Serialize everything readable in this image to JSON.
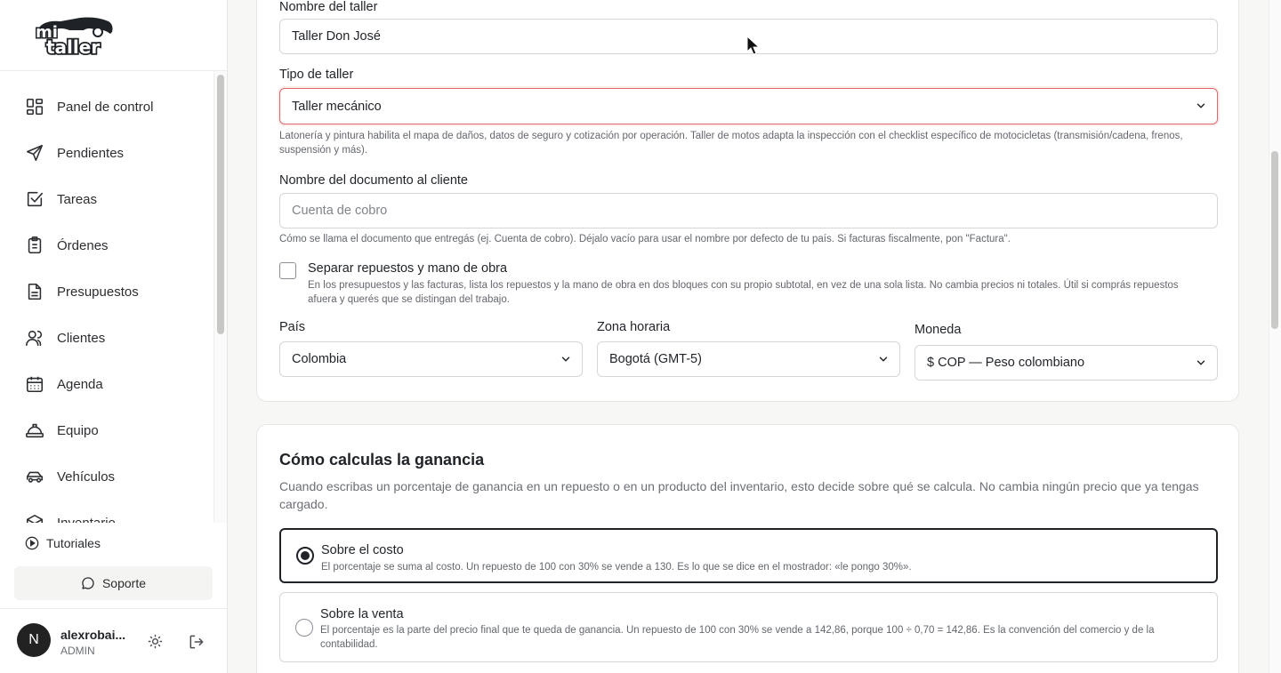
{
  "sidebar": {
    "logo_text": "mi taller",
    "items": [
      {
        "label": "Panel de control",
        "icon": "dashboard-icon"
      },
      {
        "label": "Pendientes",
        "icon": "send-icon"
      },
      {
        "label": "Tareas",
        "icon": "checkbox-icon"
      },
      {
        "label": "Órdenes",
        "icon": "clipboard-icon"
      },
      {
        "label": "Presupuestos",
        "icon": "document-icon"
      },
      {
        "label": "Clientes",
        "icon": "users-icon"
      },
      {
        "label": "Agenda",
        "icon": "calendar-icon"
      },
      {
        "label": "Equipo",
        "icon": "hardhat-icon"
      },
      {
        "label": "Vehículos",
        "icon": "car-icon"
      },
      {
        "label": "Inventario",
        "icon": "box-icon"
      }
    ],
    "tutorials": "Tutoriales",
    "support": "Soporte",
    "user": {
      "initial": "N",
      "name": "alexrobai...",
      "role": "ADMIN"
    }
  },
  "general": {
    "shop_name_label": "Nombre del taller",
    "shop_name_value": "Taller Don José",
    "shop_type_label": "Tipo de taller",
    "shop_type_value": "Taller mecánico",
    "shop_type_help": "Latonería y pintura habilita el mapa de daños, datos de seguro y cotización por operación. Taller de motos adapta la inspección con el checklist específico de motocicletas (transmisión/cadena, frenos, suspensión y más).",
    "doc_name_label": "Nombre del documento al cliente",
    "doc_name_placeholder": "Cuenta de cobro",
    "doc_name_help": "Cómo se llama el documento que entregás (ej. Cuenta de cobro). Déjalo vacío para usar el nombre por defecto de tu país. Si facturas fiscalmente, pon \"Factura\".",
    "separate_label": "Separar repuestos y mano de obra",
    "separate_help": "En los presupuestos y las facturas, lista los repuestos y la mano de obra en dos bloques con su propio subtotal, en vez de una sola lista. No cambia precios ni totales. Útil si comprás repuestos afuera y querés que se distingan del trabajo.",
    "country_label": "País",
    "country_value": "Colombia",
    "timezone_label": "Zona horaria",
    "timezone_value": "Bogotá (GMT-5)",
    "currency_label": "Moneda",
    "currency_value": "$ COP — Peso colombiano"
  },
  "profit": {
    "title": "Cómo calculas la ganancia",
    "description": "Cuando escribas un porcentaje de ganancia en un repuesto o en un producto del inventario, esto decide sobre qué se calcula. No cambia ningún precio que ya tengas cargado.",
    "options": [
      {
        "title": "Sobre el costo",
        "desc": "El porcentaje se suma al costo. Un repuesto de 100 con 30% se vende a 130. Es lo que se dice en el mostrador: «le pongo 30%».",
        "selected": true
      },
      {
        "title": "Sobre la venta",
        "desc": "El porcentaje es la parte del precio final que te queda de ganancia. Un repuesto de 100 con 30% se vende a 142,86, porque 100 ÷ 0,70 = 142,86. Es la convención del comercio y de la contabilidad.",
        "selected": false
      }
    ]
  }
}
